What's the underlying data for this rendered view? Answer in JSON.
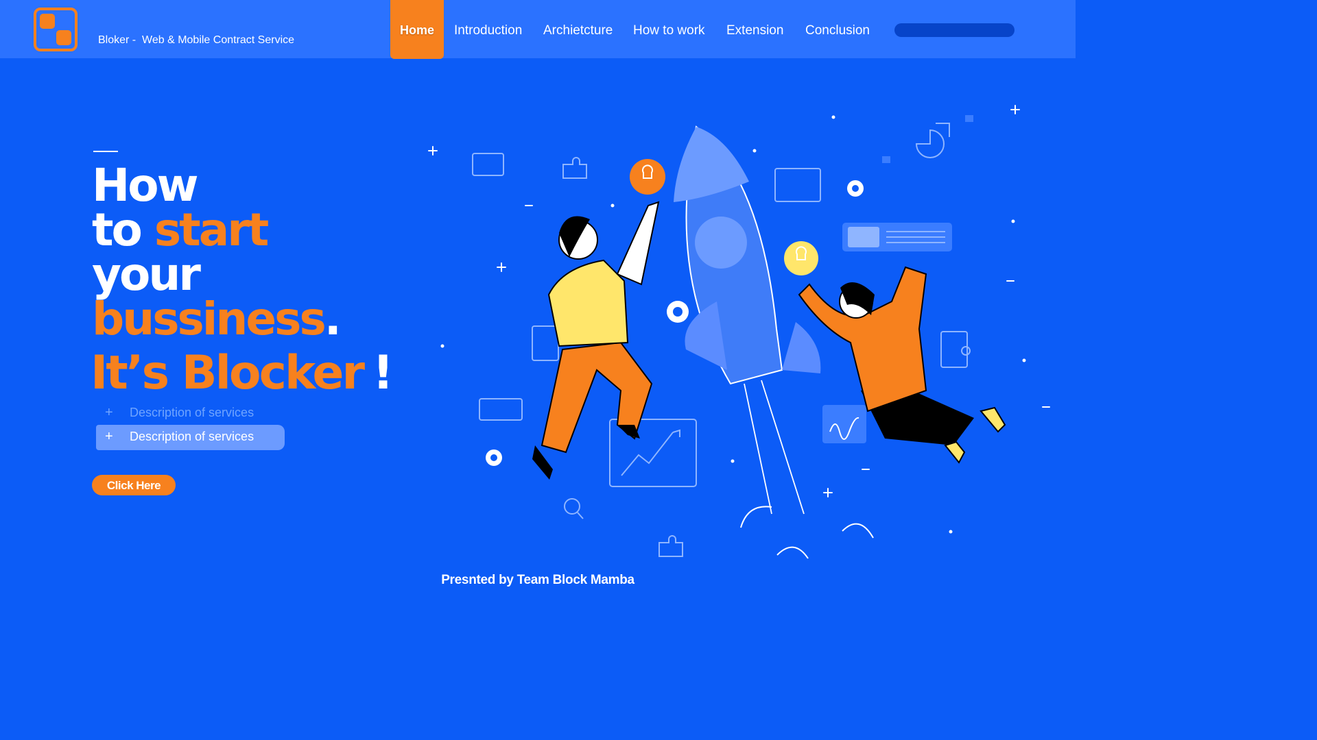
{
  "colors": {
    "background": "#0c5cf7",
    "navbar": "#2b72ff",
    "accent": "#f7811e",
    "highlight": "#6c9bff"
  },
  "header": {
    "logo_icon": "logo-squares-icon",
    "brand": "Bloker -  Web & Mobile Contract Service",
    "nav": [
      {
        "label": "Home",
        "active": true
      },
      {
        "label": "Introduction"
      },
      {
        "label": "Archietcture"
      },
      {
        "label": "How to work"
      },
      {
        "label": "Extension"
      },
      {
        "label": "Conclusion"
      }
    ],
    "search_icon": "search-pill"
  },
  "hero": {
    "line1": "How",
    "line2a": "to ",
    "line2b": "start",
    "line3": "your",
    "line4a": "bussiness",
    "line4b": ".",
    "tagline": "It’s Blocker",
    "tagline_mark": "!",
    "descriptions": [
      "Description of services",
      "Description of services"
    ],
    "plus_icon": "+",
    "cta": "Click Here"
  },
  "illustration": {
    "icon": "rocket-teamwork-illustration"
  },
  "footer": {
    "text": "Presnted by Team Block Mamba"
  }
}
